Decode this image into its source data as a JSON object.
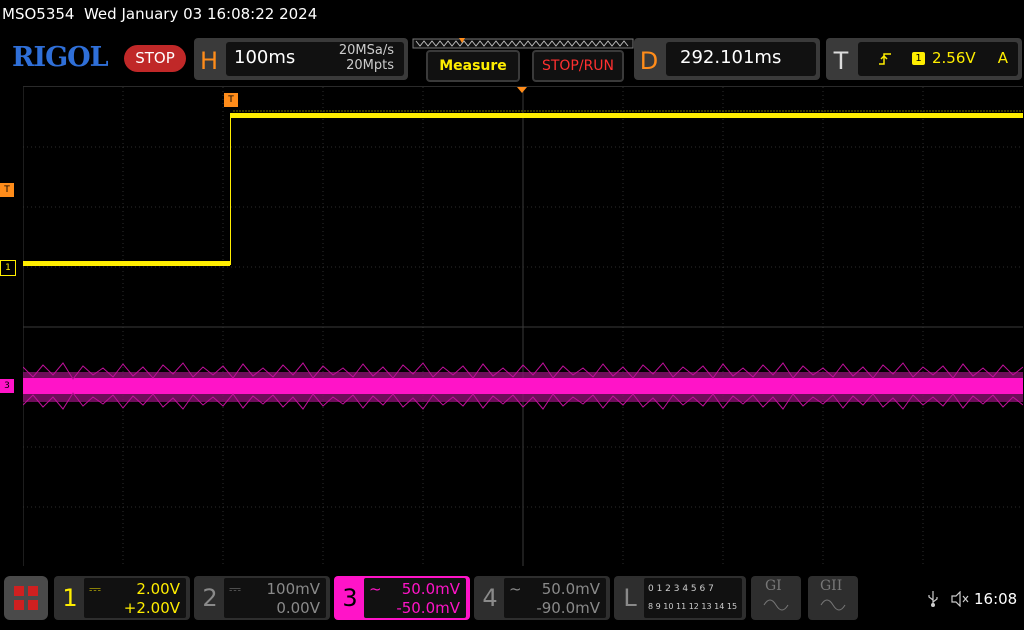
{
  "header": {
    "model_datetime": "MSO5354  Wed January 03 16:08:22 2024"
  },
  "brand": {
    "logo": "RIGOL",
    "run_status": "STOP"
  },
  "horizontal": {
    "letter": "H",
    "timebase": "100ms",
    "sample_rate": "20MSa/s",
    "memory_depth": "20Mpts"
  },
  "buttons": {
    "measure": "Measure",
    "stop_run": "STOP/RUN"
  },
  "delay": {
    "letter": "D",
    "value": "292.101ms"
  },
  "trigger": {
    "letter": "T",
    "source": "1",
    "level": "2.56V",
    "mode": "A"
  },
  "markers": {
    "trigger_top": "T",
    "trigger_left": "T",
    "ch1": "1",
    "ch3": "3"
  },
  "channels": [
    {
      "number": "1",
      "scale": "2.00V",
      "offset": "+2.00V",
      "color": "#ffee00",
      "coupling": "DC"
    },
    {
      "number": "2",
      "scale": "100mV",
      "offset": "0.00V",
      "color": "#8a8a8a",
      "coupling": "DC"
    },
    {
      "number": "3",
      "scale": "50.0mV",
      "offset": "-50.0mV",
      "color": "#ff14c8",
      "coupling": "AC"
    },
    {
      "number": "4",
      "scale": "50.0mV",
      "offset": "-90.0mV",
      "color": "#8a8a8a",
      "coupling": "AC"
    }
  ],
  "logic": {
    "letter": "L",
    "row1": "0 1 2 3   4 5 6 7",
    "row2": "8 9 10 11 12 13 14 15"
  },
  "buses": {
    "g1": "GI",
    "g2": "GII"
  },
  "status": {
    "time": "16:08"
  },
  "colors": {
    "ch1": "#ffee00",
    "ch3": "#ff14c8",
    "trigger": "#ff8c1a",
    "grid": "#2c2c2c",
    "accent_stop": "#c02828"
  }
}
